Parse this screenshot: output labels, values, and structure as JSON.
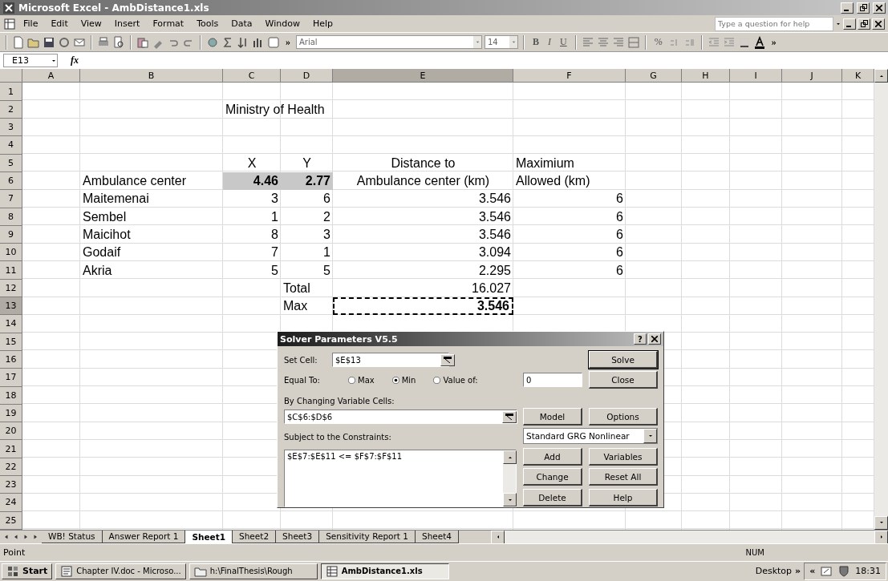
{
  "window": {
    "title": "Microsoft Excel - AmbDistance1.xls"
  },
  "menu": [
    "File",
    "Edit",
    "View",
    "Insert",
    "Format",
    "Tools",
    "Data",
    "Window",
    "Help"
  ],
  "help_box": {
    "placeholder": "Type a question for help"
  },
  "toolbar": {
    "overflow": "»",
    "font": "Arial",
    "size": "14",
    "format_buttons": [
      "B",
      "I",
      "U"
    ],
    "percent": "%",
    "end_overflow": "»"
  },
  "formula_bar": {
    "name_box": "E13",
    "function_label": "fx"
  },
  "columns": [
    {
      "label": "A",
      "selected": false
    },
    {
      "label": "B",
      "selected": false
    },
    {
      "label": "C",
      "selected": false
    },
    {
      "label": "D",
      "selected": false
    },
    {
      "label": "E",
      "selected": true
    },
    {
      "label": "F",
      "selected": false
    },
    {
      "label": "G",
      "selected": false
    },
    {
      "label": "H",
      "selected": false
    },
    {
      "label": "I",
      "selected": false
    },
    {
      "label": "J",
      "selected": false
    },
    {
      "label": "K",
      "selected": false
    }
  ],
  "rows": [
    {
      "number": "1",
      "selected": false
    },
    {
      "number": "2",
      "selected": false,
      "cells": {
        "C": {
          "text": "Ministry of Health",
          "kind": "text"
        }
      }
    },
    {
      "number": "3",
      "selected": false
    },
    {
      "number": "4",
      "selected": false
    },
    {
      "number": "5",
      "selected": false,
      "cells": {
        "C": {
          "text": "X",
          "kind": "heading"
        },
        "D": {
          "text": "Y",
          "kind": "heading"
        },
        "E": {
          "text": "Distance to",
          "kind": "heading"
        },
        "F": {
          "text": "Maximium",
          "kind": "text"
        }
      }
    },
    {
      "number": "6",
      "selected": false,
      "cells": {
        "B": {
          "text": "Ambulance center",
          "kind": "text"
        },
        "C": {
          "text": "4.46",
          "kind": "number",
          "bold": true,
          "shaded": true
        },
        "D": {
          "text": "2.77",
          "kind": "number",
          "bold": true,
          "shaded": true
        },
        "E": {
          "text": "Ambulance center (km)",
          "kind": "heading"
        },
        "F": {
          "text": "Allowed (km)",
          "kind": "text"
        }
      }
    },
    {
      "number": "7",
      "selected": false,
      "cells": {
        "B": {
          "text": "Maitemenai",
          "kind": "text"
        },
        "C": {
          "text": "3",
          "kind": "number"
        },
        "D": {
          "text": "6",
          "kind": "number"
        },
        "E": {
          "text": "3.546",
          "kind": "number"
        },
        "F": {
          "text": "6",
          "kind": "number"
        }
      }
    },
    {
      "number": "8",
      "selected": false,
      "cells": {
        "B": {
          "text": "Sembel",
          "kind": "text"
        },
        "C": {
          "text": "1",
          "kind": "number"
        },
        "D": {
          "text": "2",
          "kind": "number"
        },
        "E": {
          "text": "3.546",
          "kind": "number"
        },
        "F": {
          "text": "6",
          "kind": "number"
        }
      }
    },
    {
      "number": "9",
      "selected": false,
      "cells": {
        "B": {
          "text": "Maicihot",
          "kind": "text"
        },
        "C": {
          "text": "8",
          "kind": "number"
        },
        "D": {
          "text": "3",
          "kind": "number"
        },
        "E": {
          "text": "3.546",
          "kind": "number"
        },
        "F": {
          "text": "6",
          "kind": "number"
        }
      }
    },
    {
      "number": "10",
      "selected": false,
      "cells": {
        "B": {
          "text": "Godaif",
          "kind": "text"
        },
        "C": {
          "text": "7",
          "kind": "number"
        },
        "D": {
          "text": "1",
          "kind": "number"
        },
        "E": {
          "text": "3.094",
          "kind": "number"
        },
        "F": {
          "text": "6",
          "kind": "number"
        }
      }
    },
    {
      "number": "11",
      "selected": false,
      "cells": {
        "B": {
          "text": "Akria",
          "kind": "text"
        },
        "C": {
          "text": "5",
          "kind": "number"
        },
        "D": {
          "text": "5",
          "kind": "number"
        },
        "E": {
          "text": "2.295",
          "kind": "number"
        },
        "F": {
          "text": "6",
          "kind": "number"
        }
      }
    },
    {
      "number": "12",
      "selected": false,
      "cells": {
        "D": {
          "text": "Total",
          "kind": "text"
        },
        "E": {
          "text": "16.027",
          "kind": "number"
        }
      }
    },
    {
      "number": "13",
      "selected": true,
      "cells": {
        "D": {
          "text": "Max",
          "kind": "text"
        },
        "E": {
          "text": "3.546",
          "kind": "number",
          "bold": true,
          "marquee": true
        }
      }
    },
    {
      "number": "14",
      "selected": false
    },
    {
      "number": "15",
      "selected": false
    },
    {
      "number": "16",
      "selected": false
    },
    {
      "number": "17",
      "selected": false
    },
    {
      "number": "18",
      "selected": false
    },
    {
      "number": "19",
      "selected": false
    },
    {
      "number": "20",
      "selected": false
    },
    {
      "number": "21",
      "selected": false
    },
    {
      "number": "22",
      "selected": false
    },
    {
      "number": "23",
      "selected": false
    },
    {
      "number": "24",
      "selected": false
    },
    {
      "number": "25",
      "selected": false
    }
  ],
  "sheet_tabs": [
    {
      "label": "WB! Status",
      "selected": false
    },
    {
      "label": "Answer Report 1",
      "selected": false
    },
    {
      "label": "Sheet1",
      "selected": true
    },
    {
      "label": "Sheet2",
      "selected": false
    },
    {
      "label": "Sheet3",
      "selected": false
    },
    {
      "label": "Sensitivity Report 1",
      "selected": false
    },
    {
      "label": "Sheet4",
      "selected": false
    }
  ],
  "status_bar": {
    "mode": "Point",
    "indicator": "NUM"
  },
  "dialog": {
    "title": "Solver Parameters V5.5",
    "help": "?",
    "set_cell_label": "Set Cell:",
    "set_cell": "$E$13",
    "equal_to_label": "Equal To:",
    "options": [
      {
        "label": "Max",
        "selected": false
      },
      {
        "label": "Min",
        "selected": true
      },
      {
        "label": "Value of:",
        "selected": false
      }
    ],
    "value_of": "0",
    "changing_label": "By Changing Variable Cells:",
    "changing": "$C$6:$D$6",
    "constraints_label": "Subject to the Constraints:",
    "constraints": [
      "$E$7:$E$11 <= $F$7:$F$11"
    ],
    "engine": "Standard GRG Nonlinear",
    "buttons": {
      "solve": "Solve",
      "close": "Close",
      "model": "Model",
      "options": "Options",
      "add": "Add",
      "variables": "Variables",
      "change": "Change",
      "reset": "Reset All",
      "delete": "Delete",
      "help": "Help"
    }
  },
  "taskbar": {
    "start": "Start",
    "tasks": [
      {
        "label": "Chapter IV.doc - Microso...",
        "selected": false,
        "kind": "document"
      },
      {
        "label": "h:\\FinalThesis\\Rough",
        "selected": false,
        "kind": "folder"
      },
      {
        "label": "AmbDistance1.xls",
        "selected": true,
        "kind": "spreadsheet"
      }
    ],
    "toolbar_label": "Desktop",
    "toolbar_overflow": "»",
    "tray_expand": "«",
    "clock": "18:31"
  }
}
